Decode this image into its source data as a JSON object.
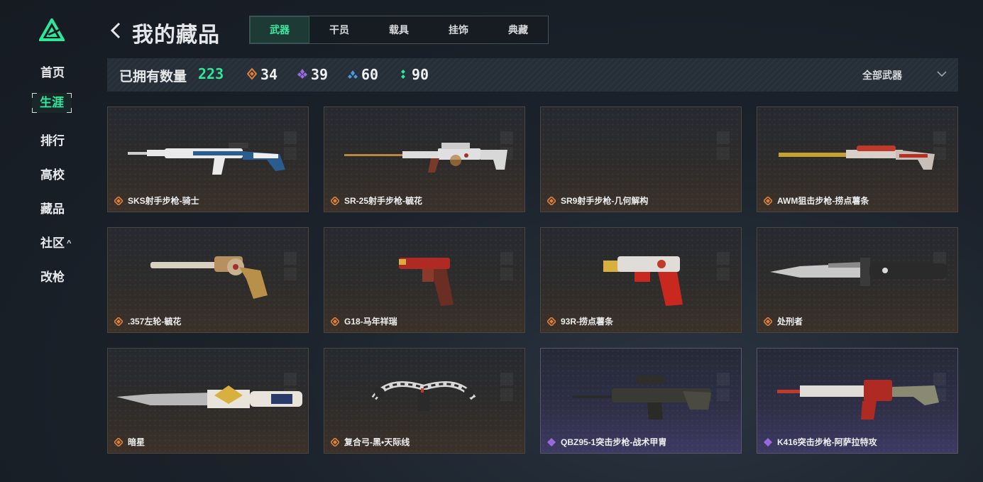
{
  "sidebar": {
    "items": [
      {
        "label": "首页"
      },
      {
        "label": "生涯"
      },
      {
        "label": "排行"
      },
      {
        "label": "高校"
      },
      {
        "label": "藏品"
      },
      {
        "label": "社区"
      },
      {
        "label": "改枪"
      }
    ],
    "active_index": 1,
    "accent": "#32e89a"
  },
  "header": {
    "title": "我的藏品",
    "tabs": [
      {
        "label": "武器"
      },
      {
        "label": "干员"
      },
      {
        "label": "载具"
      },
      {
        "label": "挂饰"
      },
      {
        "label": "典藏"
      }
    ],
    "active_tab": 0
  },
  "stats": {
    "owned_label": "已拥有数量",
    "owned_count": "223",
    "rarities": [
      {
        "icon": "orange-diamond-icon",
        "count": "34",
        "color": "#e0803a"
      },
      {
        "icon": "purple-diamond-icon",
        "count": "39",
        "color": "#9a6ae0"
      },
      {
        "icon": "blue-diamond-icon",
        "count": "60",
        "color": "#4a9ae0"
      },
      {
        "icon": "green-dots-icon",
        "count": "90",
        "color": "#2ee89a"
      }
    ],
    "filter_label": "全部武器"
  },
  "items": [
    {
      "name": "SKS射手步枪-骑士",
      "rarity": "orange"
    },
    {
      "name": "SR-25射手步枪-毓花",
      "rarity": "orange"
    },
    {
      "name": "SR9射手步枪-几何解构",
      "rarity": "orange"
    },
    {
      "name": "AWM狙击步枪-捞点薯条",
      "rarity": "orange"
    },
    {
      "name": ".357左轮-毓花",
      "rarity": "orange"
    },
    {
      "name": "G18-马年祥瑞",
      "rarity": "orange"
    },
    {
      "name": "93R-捞点薯条",
      "rarity": "orange"
    },
    {
      "name": "处刑者",
      "rarity": "orange"
    },
    {
      "name": "暗星",
      "rarity": "orange"
    },
    {
      "name": "复合弓-黑•天际线",
      "rarity": "orange"
    },
    {
      "name": "QBZ95-1突击步枪-战术甲胄",
      "rarity": "purple"
    },
    {
      "name": "K416突击步枪-阿萨拉特攻",
      "rarity": "purple"
    }
  ]
}
